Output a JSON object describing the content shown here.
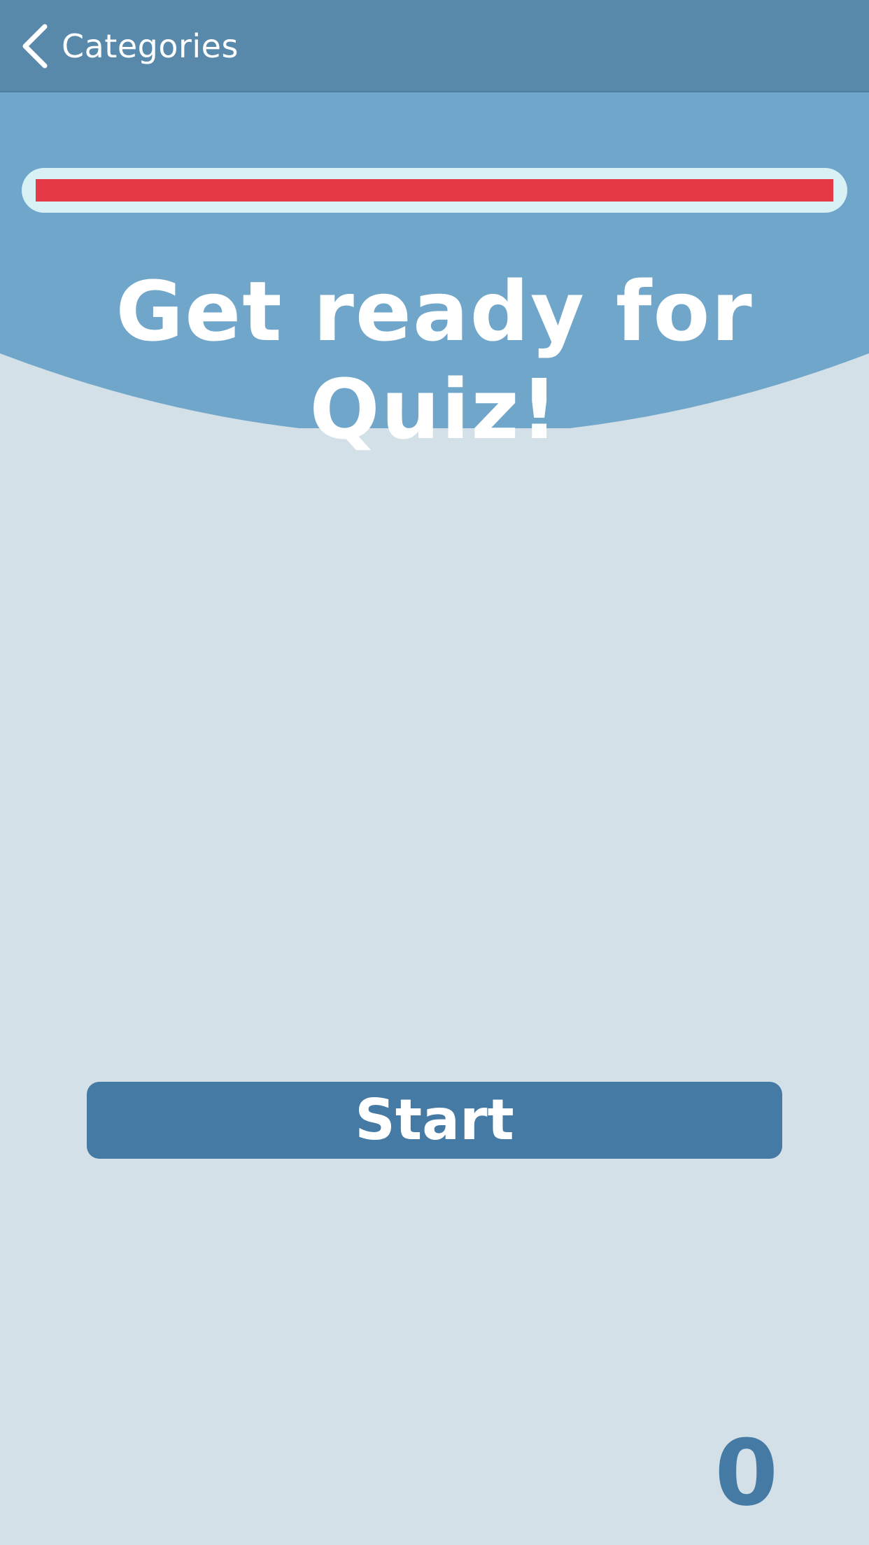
{
  "navbar": {
    "back_label": "Categories",
    "back_icon": "chevron-left-icon"
  },
  "progress": {
    "value": 1.0,
    "fill_color": "#e63946",
    "track_color": "#d8f1f4"
  },
  "quiz": {
    "title": "Get ready for Quiz!",
    "start_label": "Start",
    "score": "0"
  },
  "colors": {
    "navbar": "#5889ab",
    "header": "#70a6ca",
    "background": "#d3e0e8",
    "accent": "#447aa4"
  }
}
